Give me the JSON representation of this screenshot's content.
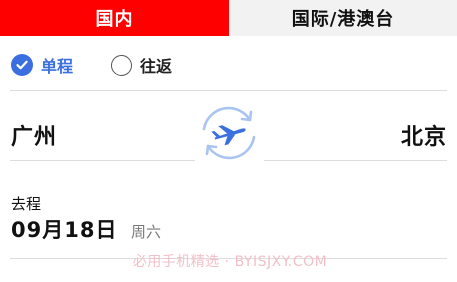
{
  "tabs": {
    "domestic": "国内",
    "international": "国际/港澳台"
  },
  "trip_type": {
    "one_way": "单程",
    "round_trip": "往返",
    "selected": "one_way"
  },
  "route": {
    "from": "广州",
    "to": "北京"
  },
  "departure": {
    "label": "去程",
    "date": "09月18日",
    "weekday": "周六"
  },
  "watermark": "必用手机精选 · BYISJXY.COM",
  "colors": {
    "tab_active_bg": "#ff0000",
    "accent_blue": "#3b6fe0",
    "swap_icon_light": "#aac4f1"
  }
}
